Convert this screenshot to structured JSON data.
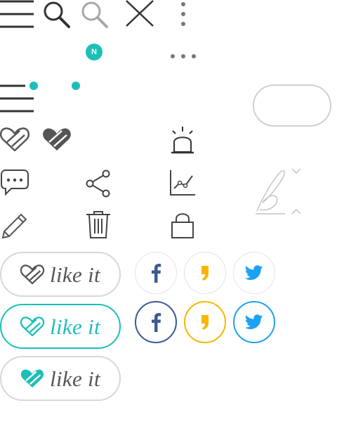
{
  "notification_badge": {
    "letter": "N"
  },
  "like_buttons": [
    {
      "label": "like it",
      "state": "default",
      "border": "#d7d7d7",
      "text": "#555555",
      "heart": "outline"
    },
    {
      "label": "like it",
      "state": "hover",
      "border": "#1bbfb8",
      "text": "#1bbfb8",
      "heart": "outline"
    },
    {
      "label": "like it",
      "state": "active",
      "border": "#d7d7d7",
      "text": "#555555",
      "heart": "filled"
    }
  ],
  "share_buttons": [
    {
      "service": "facebook",
      "icon": "facebook-f-icon",
      "color": "#3b5998",
      "active_border": "#3b5998"
    },
    {
      "service": "comma-brand",
      "icon": "comma-icon",
      "color": "#f5b800",
      "active_border": "#f5b800"
    },
    {
      "service": "twitter",
      "icon": "twitter-bird-icon",
      "color": "#1da1f2",
      "active_border": "#1da1f2"
    }
  ],
  "colors": {
    "accent": "#1bbfb8",
    "icon_dark": "#333333",
    "icon_grey": "#999999",
    "border_light": "#e3e3e3"
  }
}
